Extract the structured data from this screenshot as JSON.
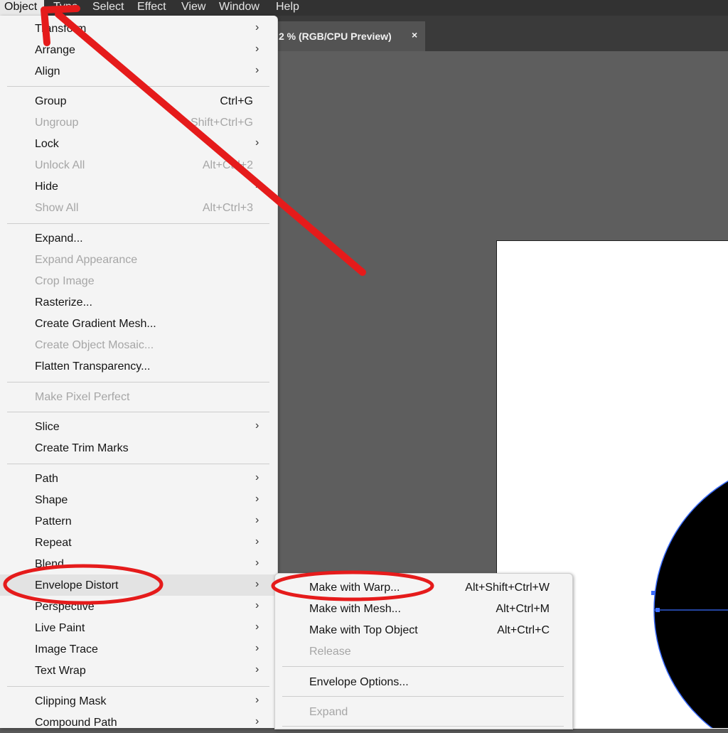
{
  "menubar": {
    "items": [
      "Object",
      "Type",
      "Select",
      "Effect",
      "View",
      "Window",
      "Help"
    ]
  },
  "doc_tab": {
    "title": "2 % (RGB/CPU Preview)",
    "close": "×"
  },
  "menu": {
    "items": [
      {
        "label": "Transform",
        "shortcut": "",
        "submenu": true,
        "disabled": false
      },
      {
        "label": "Arrange",
        "shortcut": "",
        "submenu": true,
        "disabled": false
      },
      {
        "label": "Align",
        "shortcut": "",
        "submenu": true,
        "disabled": false
      },
      {
        "label": "Group",
        "shortcut": "Ctrl+G",
        "submenu": false,
        "disabled": false
      },
      {
        "label": "Ungroup",
        "shortcut": "Shift+Ctrl+G",
        "submenu": false,
        "disabled": true
      },
      {
        "label": "Lock",
        "shortcut": "",
        "submenu": true,
        "disabled": false
      },
      {
        "label": "Unlock All",
        "shortcut": "Alt+Ctrl+2",
        "submenu": false,
        "disabled": true
      },
      {
        "label": "Hide",
        "shortcut": "",
        "submenu": true,
        "disabled": false
      },
      {
        "label": "Show All",
        "shortcut": "Alt+Ctrl+3",
        "submenu": false,
        "disabled": true
      },
      {
        "label": "Expand...",
        "shortcut": "",
        "submenu": false,
        "disabled": false
      },
      {
        "label": "Expand Appearance",
        "shortcut": "",
        "submenu": false,
        "disabled": true
      },
      {
        "label": "Crop Image",
        "shortcut": "",
        "submenu": false,
        "disabled": true
      },
      {
        "label": "Rasterize...",
        "shortcut": "",
        "submenu": false,
        "disabled": false
      },
      {
        "label": "Create Gradient Mesh...",
        "shortcut": "",
        "submenu": false,
        "disabled": false
      },
      {
        "label": "Create Object Mosaic...",
        "shortcut": "",
        "submenu": false,
        "disabled": true
      },
      {
        "label": "Flatten Transparency...",
        "shortcut": "",
        "submenu": false,
        "disabled": false
      },
      {
        "label": "Make Pixel Perfect",
        "shortcut": "",
        "submenu": false,
        "disabled": true
      },
      {
        "label": "Slice",
        "shortcut": "",
        "submenu": true,
        "disabled": false
      },
      {
        "label": "Create Trim Marks",
        "shortcut": "",
        "submenu": false,
        "disabled": false
      },
      {
        "label": "Path",
        "shortcut": "",
        "submenu": true,
        "disabled": false
      },
      {
        "label": "Shape",
        "shortcut": "",
        "submenu": true,
        "disabled": false
      },
      {
        "label": "Pattern",
        "shortcut": "",
        "submenu": true,
        "disabled": false
      },
      {
        "label": "Repeat",
        "shortcut": "",
        "submenu": true,
        "disabled": false
      },
      {
        "label": "Blend",
        "shortcut": "",
        "submenu": true,
        "disabled": false
      },
      {
        "label": "Envelope Distort",
        "shortcut": "",
        "submenu": true,
        "disabled": false
      },
      {
        "label": "Perspective",
        "shortcut": "",
        "submenu": true,
        "disabled": false
      },
      {
        "label": "Live Paint",
        "shortcut": "",
        "submenu": true,
        "disabled": false
      },
      {
        "label": "Image Trace",
        "shortcut": "",
        "submenu": true,
        "disabled": false
      },
      {
        "label": "Text Wrap",
        "shortcut": "",
        "submenu": true,
        "disabled": false
      },
      {
        "label": "Clipping Mask",
        "shortcut": "",
        "submenu": true,
        "disabled": false
      },
      {
        "label": "Compound Path",
        "shortcut": "",
        "submenu": true,
        "disabled": false
      }
    ]
  },
  "submenu": {
    "items": [
      {
        "label": "Make with Warp...",
        "shortcut": "Alt+Shift+Ctrl+W",
        "disabled": false
      },
      {
        "label": "Make with Mesh...",
        "shortcut": "Alt+Ctrl+M",
        "disabled": false
      },
      {
        "label": "Make with Top Object",
        "shortcut": "Alt+Ctrl+C",
        "disabled": false
      },
      {
        "label": "Release",
        "shortcut": "",
        "disabled": true
      },
      {
        "label": "Envelope Options...",
        "shortcut": "",
        "disabled": false
      },
      {
        "label": "Expand",
        "shortcut": "",
        "disabled": true
      }
    ]
  },
  "arrow_glyph": "›",
  "colors": {
    "annotation": "#e51b1b",
    "selection": "#3b6cff",
    "menu_bg": "#f4f4f4",
    "canvas": "#5e5e5e"
  }
}
